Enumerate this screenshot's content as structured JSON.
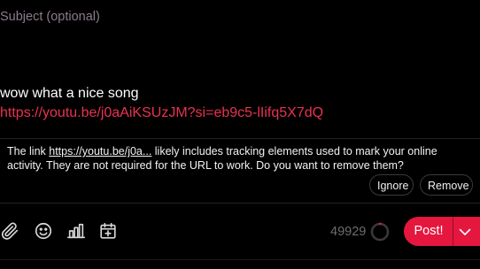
{
  "subject": {
    "placeholder": "Subject (optional)"
  },
  "compose": {
    "text_line": "wow what a nice song",
    "link_line": "https://youtu.be/j0aAiKSUzJM?si=eb9c5-lIifq5X7dQ"
  },
  "tracking_notice": {
    "prefix": "The link ",
    "link_text": "https://youtu.be/j0a...",
    "suffix": " likely includes tracking elements used to mark your online activity. They are not required for the URL to work. Do you want to remove them?",
    "ignore_label": "Ignore",
    "remove_label": "Remove"
  },
  "toolbar": {
    "icons": [
      "paperclip-icon",
      "smiley-icon",
      "poll-icon",
      "calendar-icon"
    ],
    "char_count": "49929",
    "usage_fraction": 0.002,
    "post_label": "Post!"
  },
  "colors": {
    "accent": "#e5173f",
    "link": "#e8334f",
    "background": "#000000",
    "muted": "#8a7b8a"
  }
}
